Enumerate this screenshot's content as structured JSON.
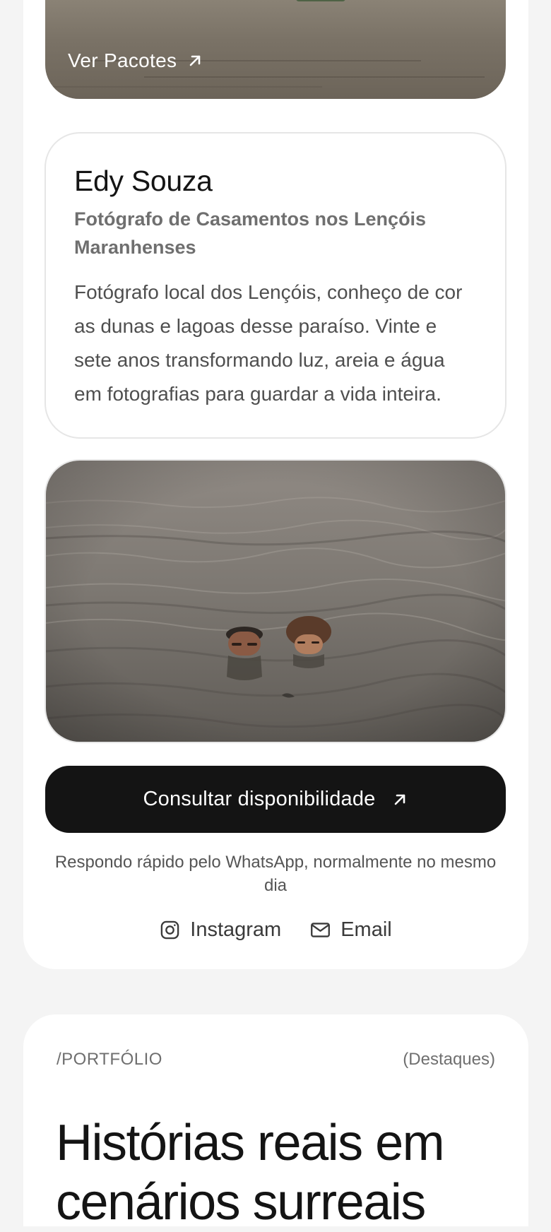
{
  "hero": {
    "link_label": "Ver Pacotes",
    "link_icon": "arrow-up-right-icon"
  },
  "bio": {
    "name": "Edy Souza",
    "role": "Fotógrafo de Casamentos nos Lençóis Maranhenses",
    "description": "Fotógrafo local dos Lençóis, conheço de cor as dunas e lagoas desse paraíso. Vinte e sete anos transformando luz, areia e água em fotografias para guardar a vida inteira."
  },
  "cta": {
    "label": "Consultar disponibilidade",
    "icon": "arrow-up-right-icon",
    "note": "Respondo rápido pelo WhatsApp, normalmente no mesmo dia"
  },
  "social": {
    "items": [
      {
        "label": "Instagram",
        "icon": "instagram-icon"
      },
      {
        "label": "Email",
        "icon": "mail-icon"
      }
    ]
  },
  "portfolio": {
    "eyebrow": "/PORTFÓLIO",
    "tag": "(Destaques)",
    "heading": "Histórias reais em cenários surreais"
  },
  "colors": {
    "page_background": "#f4f4f4",
    "card_background": "#ffffff",
    "button_background": "#141414",
    "muted_text": "#6f6f6f"
  }
}
